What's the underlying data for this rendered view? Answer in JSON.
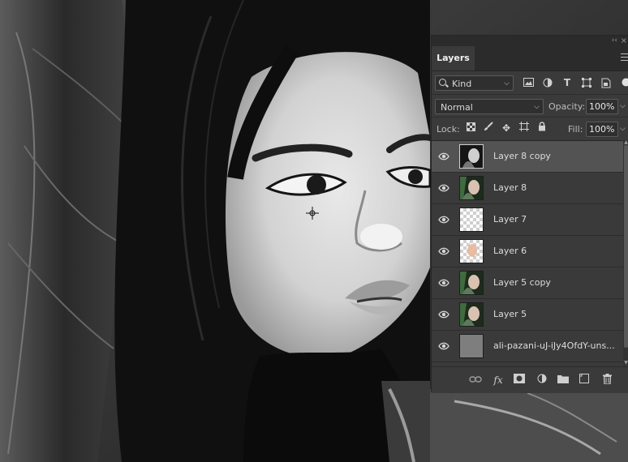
{
  "canvas": {
    "cursor_icon": "crosshair-target-icon"
  },
  "panel": {
    "collapse_glyph": "‹‹",
    "close_glyph": "×",
    "tab_label": "Layers",
    "filter": {
      "kind_label": "Kind",
      "icons": [
        "image-filter-icon",
        "adjustment-filter-icon",
        "type-filter-icon",
        "shape-filter-icon",
        "smart-object-filter-icon",
        "filter-toggle-icon"
      ]
    },
    "blend": {
      "mode": "Normal",
      "opacity_label": "Opacity:",
      "opacity_value": "100%"
    },
    "lock": {
      "label": "Lock:",
      "fill_label": "Fill:",
      "fill_value": "100%",
      "icons": [
        "lock-transparent-icon",
        "lock-paint-icon",
        "lock-position-icon",
        "lock-artboard-icon",
        "lock-all-icon"
      ]
    },
    "layers": [
      {
        "name": "Layer 8 copy",
        "thumb": "dark-portrait",
        "selected": true
      },
      {
        "name": "Layer 8",
        "thumb": "color-portrait",
        "selected": false
      },
      {
        "name": "Layer 7",
        "thumb": "transparent",
        "selected": false
      },
      {
        "name": "Layer 6",
        "thumb": "transparent-skin",
        "selected": false
      },
      {
        "name": "Layer 5 copy",
        "thumb": "color-portrait",
        "selected": false
      },
      {
        "name": "Layer 5",
        "thumb": "color-portrait",
        "selected": false
      },
      {
        "name": "ali-pazani-uJ-iJy4OfdY-uns...",
        "thumb": "gray",
        "selected": false
      }
    ],
    "bottom_icons": [
      "link-layers-icon",
      "fx-icon",
      "add-mask-icon",
      "adjustment-layer-icon",
      "group-folder-icon",
      "new-layer-icon",
      "trash-icon"
    ],
    "fx_label": "fx"
  }
}
